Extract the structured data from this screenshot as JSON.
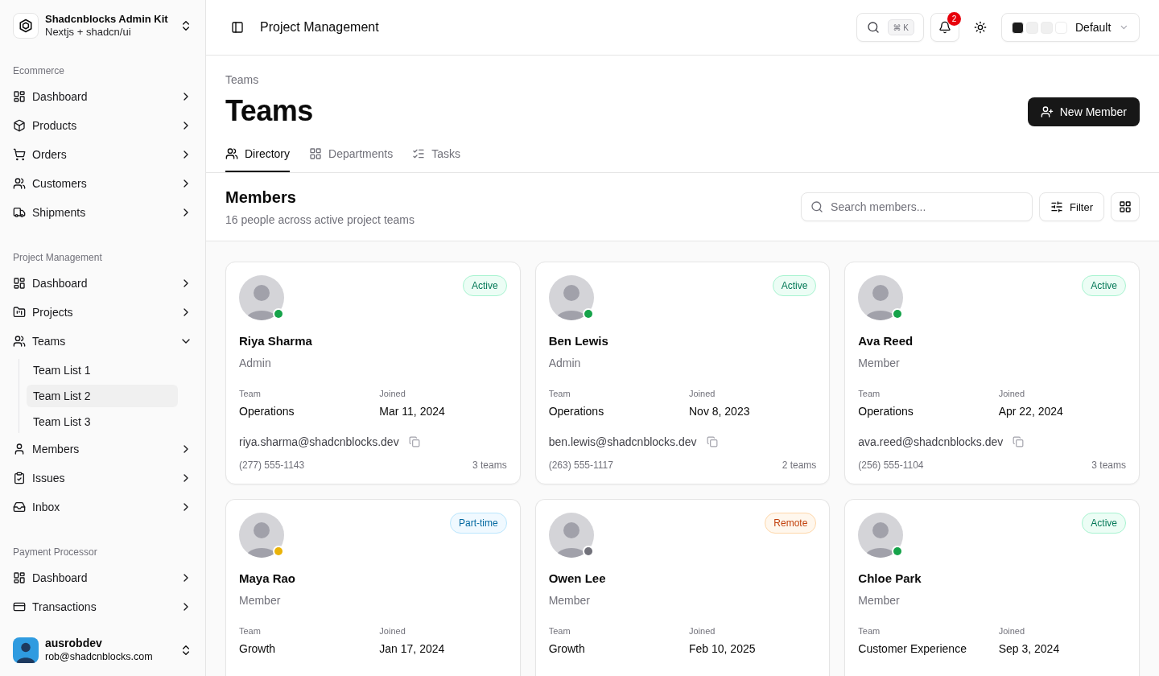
{
  "sidebar": {
    "workspace": {
      "name": "Shadcnblocks Admin Kit",
      "subtitle": "Nextjs + shadcn/ui"
    },
    "groups": [
      {
        "label": "Ecommerce",
        "items": [
          {
            "label": "Dashboard",
            "expanded": false
          },
          {
            "label": "Products",
            "expanded": false
          },
          {
            "label": "Orders",
            "expanded": false
          },
          {
            "label": "Customers",
            "expanded": false
          },
          {
            "label": "Shipments",
            "expanded": false
          }
        ]
      },
      {
        "label": "Project Management",
        "items": [
          {
            "label": "Dashboard",
            "expanded": false
          },
          {
            "label": "Projects",
            "expanded": false
          },
          {
            "label": "Teams",
            "expanded": true,
            "children": [
              {
                "label": "Team List 1",
                "selected": false
              },
              {
                "label": "Team List 2",
                "selected": true
              },
              {
                "label": "Team List 3",
                "selected": false
              }
            ]
          },
          {
            "label": "Members",
            "expanded": false
          },
          {
            "label": "Issues",
            "expanded": false
          },
          {
            "label": "Inbox",
            "expanded": false
          }
        ]
      },
      {
        "label": "Payment Processor",
        "items": [
          {
            "label": "Dashboard",
            "expanded": false
          },
          {
            "label": "Transactions",
            "expanded": false
          }
        ]
      }
    ],
    "user": {
      "name": "ausrobdev",
      "email": "rob@shadcnblocks.com"
    }
  },
  "header": {
    "title": "Project Management",
    "search_shortcut": "⌘ K",
    "notifications": "2",
    "theme": {
      "swatches": [
        {
          "color": "#1c1c1c"
        },
        {
          "color": "#f0f0f0"
        },
        {
          "color": "#f0f0f0"
        },
        {
          "color": "#ffffff"
        }
      ],
      "label": "Default"
    }
  },
  "page": {
    "breadcrumb": "Teams",
    "title": "Teams",
    "action": "New Member",
    "tabs": [
      {
        "label": "Directory",
        "selected": true
      },
      {
        "label": "Departments",
        "selected": false
      },
      {
        "label": "Tasks",
        "selected": false
      }
    ]
  },
  "members_section": {
    "title": "Members",
    "subtitle": "16 people across active project teams",
    "search": {
      "placeholder": "Search members..."
    },
    "filter": "Filter"
  },
  "members": [
    {
      "name": "Riya Sharma",
      "role": "Admin",
      "status": {
        "label": "Active",
        "kind": "active"
      },
      "color": "#16a34a",
      "team_label": "Team",
      "team": "Operations",
      "joined_label": "Joined",
      "joined": "Mar 11, 2024",
      "email": "riya.sharma@shadcnblocks.dev",
      "phone": "(277) 555-1143",
      "teams": "3 teams"
    },
    {
      "name": "Ben Lewis",
      "role": "Admin",
      "status": {
        "label": "Active",
        "kind": "active"
      },
      "color": "#16a34a",
      "team_label": "Team",
      "team": "Operations",
      "joined_label": "Joined",
      "joined": "Nov 8, 2023",
      "email": "ben.lewis@shadcnblocks.dev",
      "phone": "(263) 555-1117",
      "teams": "2 teams"
    },
    {
      "name": "Ava Reed",
      "role": "Member",
      "status": {
        "label": "Active",
        "kind": "active"
      },
      "color": "#16a34a",
      "team_label": "Team",
      "team": "Operations",
      "joined_label": "Joined",
      "joined": "Apr 22, 2024",
      "email": "ava.reed@shadcnblocks.dev",
      "phone": "(256) 555-1104",
      "teams": "3 teams"
    },
    {
      "name": "Maya Rao",
      "role": "Member",
      "status": {
        "label": "Part-time",
        "kind": "part-time"
      },
      "color": "#eab308",
      "team_label": "Team",
      "team": "Growth",
      "joined_label": "Joined",
      "joined": "Jan 17, 2024"
    },
    {
      "name": "Owen Lee",
      "role": "Member",
      "status": {
        "label": "Remote",
        "kind": "remote"
      },
      "color": "#71717a",
      "team_label": "Team",
      "team": "Growth",
      "joined_label": "Joined",
      "joined": "Feb 10, 2025"
    },
    {
      "name": "Chloe Park",
      "role": "Member",
      "status": {
        "label": "Active",
        "kind": "active"
      },
      "color": "#16a34a",
      "team_label": "Team",
      "team": "Customer Experience",
      "joined_label": "Joined",
      "joined": "Sep 3, 2024"
    }
  ]
}
